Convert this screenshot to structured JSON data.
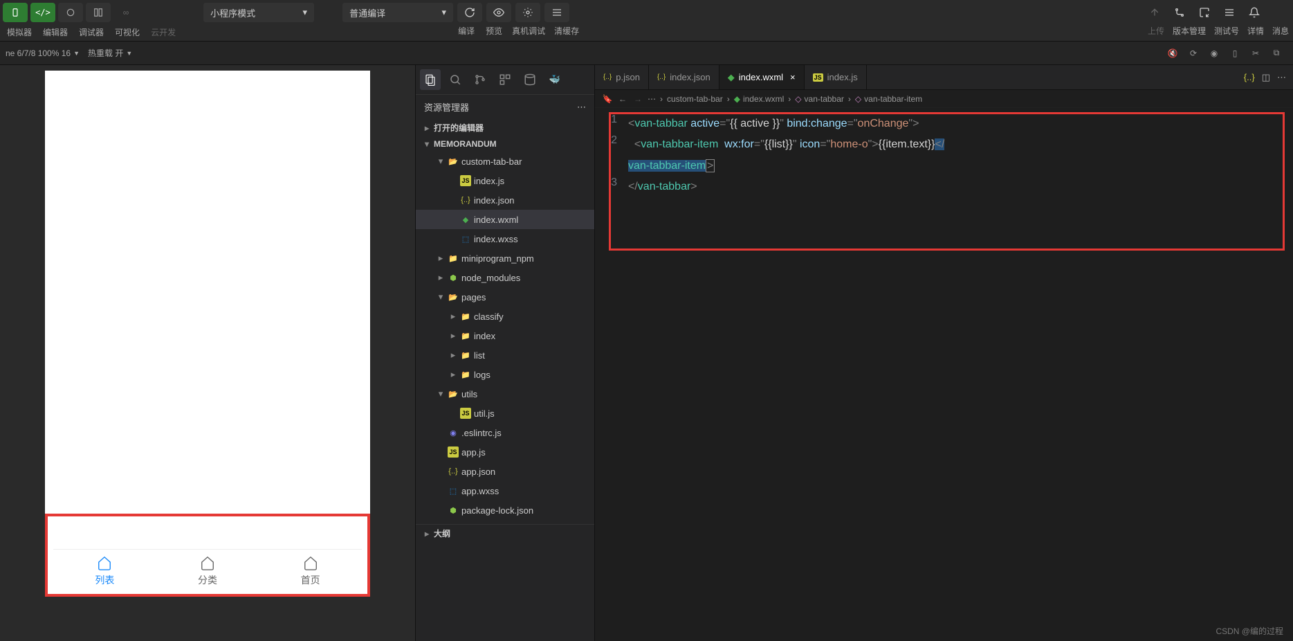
{
  "toolbar": {
    "left_labels": [
      "模拟器",
      "编辑器",
      "调试器",
      "可视化",
      "云开发"
    ],
    "mode_select": "小程序模式",
    "compile_select": "普通编译",
    "center_labels": [
      "编译",
      "预览",
      "真机调试",
      "清缓存"
    ],
    "right_labels": [
      "上传",
      "版本管理",
      "测试号",
      "详情",
      "消息"
    ]
  },
  "subbar": {
    "device": "ne 6/7/8 100% 16",
    "hotreload": "热重载 开"
  },
  "simulator": {
    "tabs": [
      {
        "text": "列表",
        "active": true
      },
      {
        "text": "分类",
        "active": false
      },
      {
        "text": "首页",
        "active": false
      }
    ]
  },
  "explorer": {
    "title": "资源管理器",
    "open_editors": "打开的编辑器",
    "project": "MEMORANDUM",
    "outline": "大纲",
    "tree": [
      {
        "d": 1,
        "t": "folder-open",
        "n": "custom-tab-bar",
        "chev": "▾"
      },
      {
        "d": 2,
        "t": "js",
        "n": "index.js"
      },
      {
        "d": 2,
        "t": "json",
        "n": "index.json"
      },
      {
        "d": 2,
        "t": "wxml",
        "n": "index.wxml",
        "sel": true
      },
      {
        "d": 2,
        "t": "wxss",
        "n": "index.wxss"
      },
      {
        "d": 1,
        "t": "folder",
        "n": "miniprogram_npm",
        "chev": "▸"
      },
      {
        "d": 1,
        "t": "node",
        "n": "node_modules",
        "chev": "▸"
      },
      {
        "d": 1,
        "t": "folder-open2",
        "n": "pages",
        "chev": "▾"
      },
      {
        "d": 2,
        "t": "folder",
        "n": "classify",
        "chev": "▸"
      },
      {
        "d": 2,
        "t": "folder",
        "n": "index",
        "chev": "▸"
      },
      {
        "d": 2,
        "t": "folder",
        "n": "list",
        "chev": "▸"
      },
      {
        "d": 2,
        "t": "folder2",
        "n": "logs",
        "chev": "▸"
      },
      {
        "d": 1,
        "t": "folder-open2",
        "n": "utils",
        "chev": "▾"
      },
      {
        "d": 2,
        "t": "js",
        "n": "util.js"
      },
      {
        "d": 1,
        "t": "eslint",
        "n": ".eslintrc.js"
      },
      {
        "d": 1,
        "t": "js",
        "n": "app.js"
      },
      {
        "d": 1,
        "t": "json",
        "n": "app.json"
      },
      {
        "d": 1,
        "t": "wxss",
        "n": "app.wxss"
      },
      {
        "d": 1,
        "t": "node",
        "n": "package-lock.json"
      }
    ]
  },
  "tabs": {
    "items": [
      {
        "icon": "json",
        "name": "p.json"
      },
      {
        "icon": "json",
        "name": "index.json"
      },
      {
        "icon": "wxml",
        "name": "index.wxml",
        "active": true,
        "close": true
      },
      {
        "icon": "js",
        "name": "index.js"
      }
    ]
  },
  "breadcrumbs": [
    "custom-tab-bar",
    "index.wxml",
    "van-tabbar",
    "van-tabbar-item"
  ],
  "code": {
    "l1": {
      "tag": "van-tabbar",
      "a1": "active",
      "v1": "{{ active }}",
      "a2": "bind:change",
      "v2": "onChange"
    },
    "l2": {
      "tag": "van-tabbar-item",
      "a1": "wx:for",
      "v1": "{{list}}",
      "a2": "icon",
      "v2": "home-o",
      "txt": "{{item.text}}"
    },
    "l2b": {
      "tag": "van-tabbar-item"
    },
    "l3": {
      "tag": "van-tabbar"
    }
  },
  "watermark": "CSDN @编的过程"
}
